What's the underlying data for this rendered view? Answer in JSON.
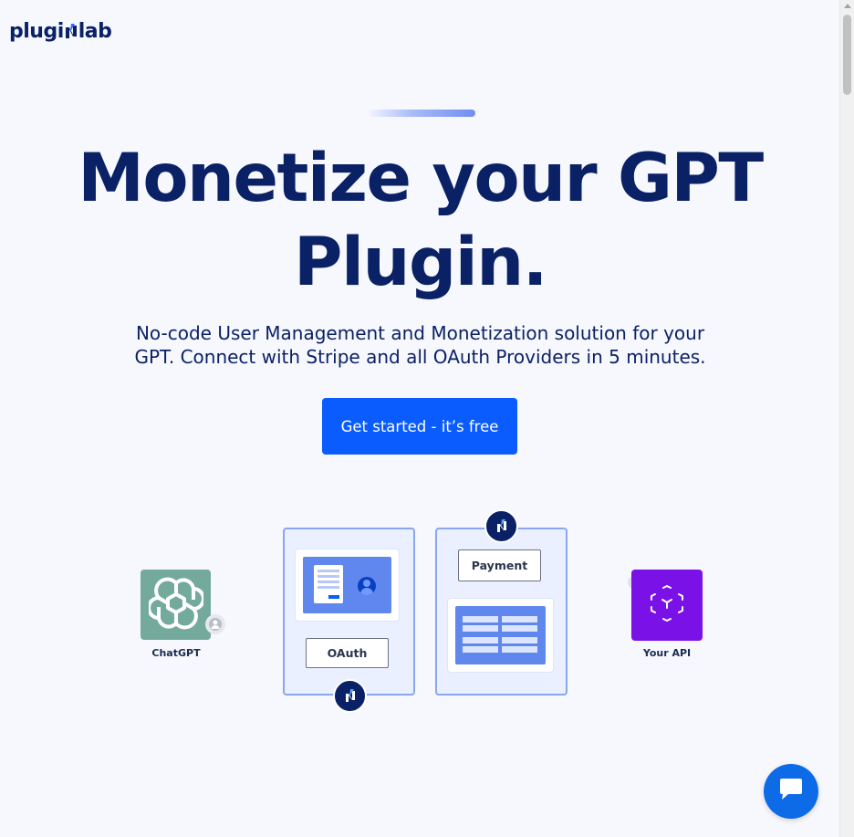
{
  "brand": {
    "logo_prefix": "plugi",
    "logo_suffix": "lab"
  },
  "hero": {
    "headline_line1": "Monetize your GPT",
    "headline_line2": "Plugin.",
    "subtitle": "No-code User Management and Monetization solution for your GPT. Connect with Stripe and all OAuth Providers in 5 minutes.",
    "cta_label": "Get started - it’s free"
  },
  "diagram": {
    "left_node_label": "ChatGPT",
    "right_node_label": "Your API",
    "oauth_chip": "OAuth",
    "payment_chip": "Payment"
  },
  "colors": {
    "primary": "#0a5cff",
    "navy": "#0b2166",
    "chatgpt_green": "#74aa9c",
    "api_purple": "#7a12e8",
    "card_border": "#8aa6ee",
    "chat_widget": "#0d6be8"
  },
  "icons": {
    "chat_widget": "chat-bubble-icon",
    "chatgpt": "openai-logo-icon",
    "api": "cube-icon",
    "bolt": "pluginlab-bolt-icon"
  }
}
